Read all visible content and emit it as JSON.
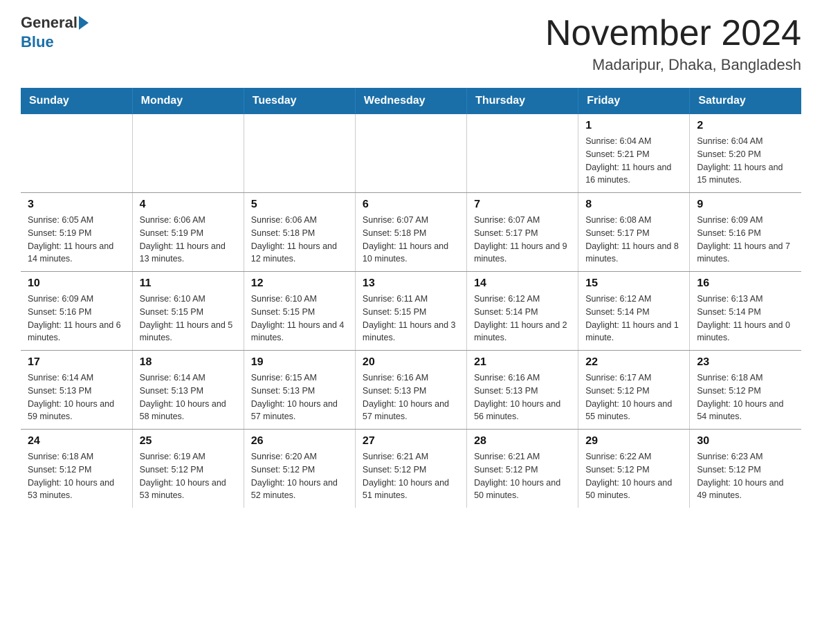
{
  "logo": {
    "general": "General",
    "blue": "Blue"
  },
  "header": {
    "title": "November 2024",
    "subtitle": "Madaripur, Dhaka, Bangladesh"
  },
  "days": [
    "Sunday",
    "Monday",
    "Tuesday",
    "Wednesday",
    "Thursday",
    "Friday",
    "Saturday"
  ],
  "weeks": [
    [
      {
        "day": "",
        "info": ""
      },
      {
        "day": "",
        "info": ""
      },
      {
        "day": "",
        "info": ""
      },
      {
        "day": "",
        "info": ""
      },
      {
        "day": "",
        "info": ""
      },
      {
        "day": "1",
        "info": "Sunrise: 6:04 AM\nSunset: 5:21 PM\nDaylight: 11 hours and 16 minutes."
      },
      {
        "day": "2",
        "info": "Sunrise: 6:04 AM\nSunset: 5:20 PM\nDaylight: 11 hours and 15 minutes."
      }
    ],
    [
      {
        "day": "3",
        "info": "Sunrise: 6:05 AM\nSunset: 5:19 PM\nDaylight: 11 hours and 14 minutes."
      },
      {
        "day": "4",
        "info": "Sunrise: 6:06 AM\nSunset: 5:19 PM\nDaylight: 11 hours and 13 minutes."
      },
      {
        "day": "5",
        "info": "Sunrise: 6:06 AM\nSunset: 5:18 PM\nDaylight: 11 hours and 12 minutes."
      },
      {
        "day": "6",
        "info": "Sunrise: 6:07 AM\nSunset: 5:18 PM\nDaylight: 11 hours and 10 minutes."
      },
      {
        "day": "7",
        "info": "Sunrise: 6:07 AM\nSunset: 5:17 PM\nDaylight: 11 hours and 9 minutes."
      },
      {
        "day": "8",
        "info": "Sunrise: 6:08 AM\nSunset: 5:17 PM\nDaylight: 11 hours and 8 minutes."
      },
      {
        "day": "9",
        "info": "Sunrise: 6:09 AM\nSunset: 5:16 PM\nDaylight: 11 hours and 7 minutes."
      }
    ],
    [
      {
        "day": "10",
        "info": "Sunrise: 6:09 AM\nSunset: 5:16 PM\nDaylight: 11 hours and 6 minutes."
      },
      {
        "day": "11",
        "info": "Sunrise: 6:10 AM\nSunset: 5:15 PM\nDaylight: 11 hours and 5 minutes."
      },
      {
        "day": "12",
        "info": "Sunrise: 6:10 AM\nSunset: 5:15 PM\nDaylight: 11 hours and 4 minutes."
      },
      {
        "day": "13",
        "info": "Sunrise: 6:11 AM\nSunset: 5:15 PM\nDaylight: 11 hours and 3 minutes."
      },
      {
        "day": "14",
        "info": "Sunrise: 6:12 AM\nSunset: 5:14 PM\nDaylight: 11 hours and 2 minutes."
      },
      {
        "day": "15",
        "info": "Sunrise: 6:12 AM\nSunset: 5:14 PM\nDaylight: 11 hours and 1 minute."
      },
      {
        "day": "16",
        "info": "Sunrise: 6:13 AM\nSunset: 5:14 PM\nDaylight: 11 hours and 0 minutes."
      }
    ],
    [
      {
        "day": "17",
        "info": "Sunrise: 6:14 AM\nSunset: 5:13 PM\nDaylight: 10 hours and 59 minutes."
      },
      {
        "day": "18",
        "info": "Sunrise: 6:14 AM\nSunset: 5:13 PM\nDaylight: 10 hours and 58 minutes."
      },
      {
        "day": "19",
        "info": "Sunrise: 6:15 AM\nSunset: 5:13 PM\nDaylight: 10 hours and 57 minutes."
      },
      {
        "day": "20",
        "info": "Sunrise: 6:16 AM\nSunset: 5:13 PM\nDaylight: 10 hours and 57 minutes."
      },
      {
        "day": "21",
        "info": "Sunrise: 6:16 AM\nSunset: 5:13 PM\nDaylight: 10 hours and 56 minutes."
      },
      {
        "day": "22",
        "info": "Sunrise: 6:17 AM\nSunset: 5:12 PM\nDaylight: 10 hours and 55 minutes."
      },
      {
        "day": "23",
        "info": "Sunrise: 6:18 AM\nSunset: 5:12 PM\nDaylight: 10 hours and 54 minutes."
      }
    ],
    [
      {
        "day": "24",
        "info": "Sunrise: 6:18 AM\nSunset: 5:12 PM\nDaylight: 10 hours and 53 minutes."
      },
      {
        "day": "25",
        "info": "Sunrise: 6:19 AM\nSunset: 5:12 PM\nDaylight: 10 hours and 53 minutes."
      },
      {
        "day": "26",
        "info": "Sunrise: 6:20 AM\nSunset: 5:12 PM\nDaylight: 10 hours and 52 minutes."
      },
      {
        "day": "27",
        "info": "Sunrise: 6:21 AM\nSunset: 5:12 PM\nDaylight: 10 hours and 51 minutes."
      },
      {
        "day": "28",
        "info": "Sunrise: 6:21 AM\nSunset: 5:12 PM\nDaylight: 10 hours and 50 minutes."
      },
      {
        "day": "29",
        "info": "Sunrise: 6:22 AM\nSunset: 5:12 PM\nDaylight: 10 hours and 50 minutes."
      },
      {
        "day": "30",
        "info": "Sunrise: 6:23 AM\nSunset: 5:12 PM\nDaylight: 10 hours and 49 minutes."
      }
    ]
  ]
}
